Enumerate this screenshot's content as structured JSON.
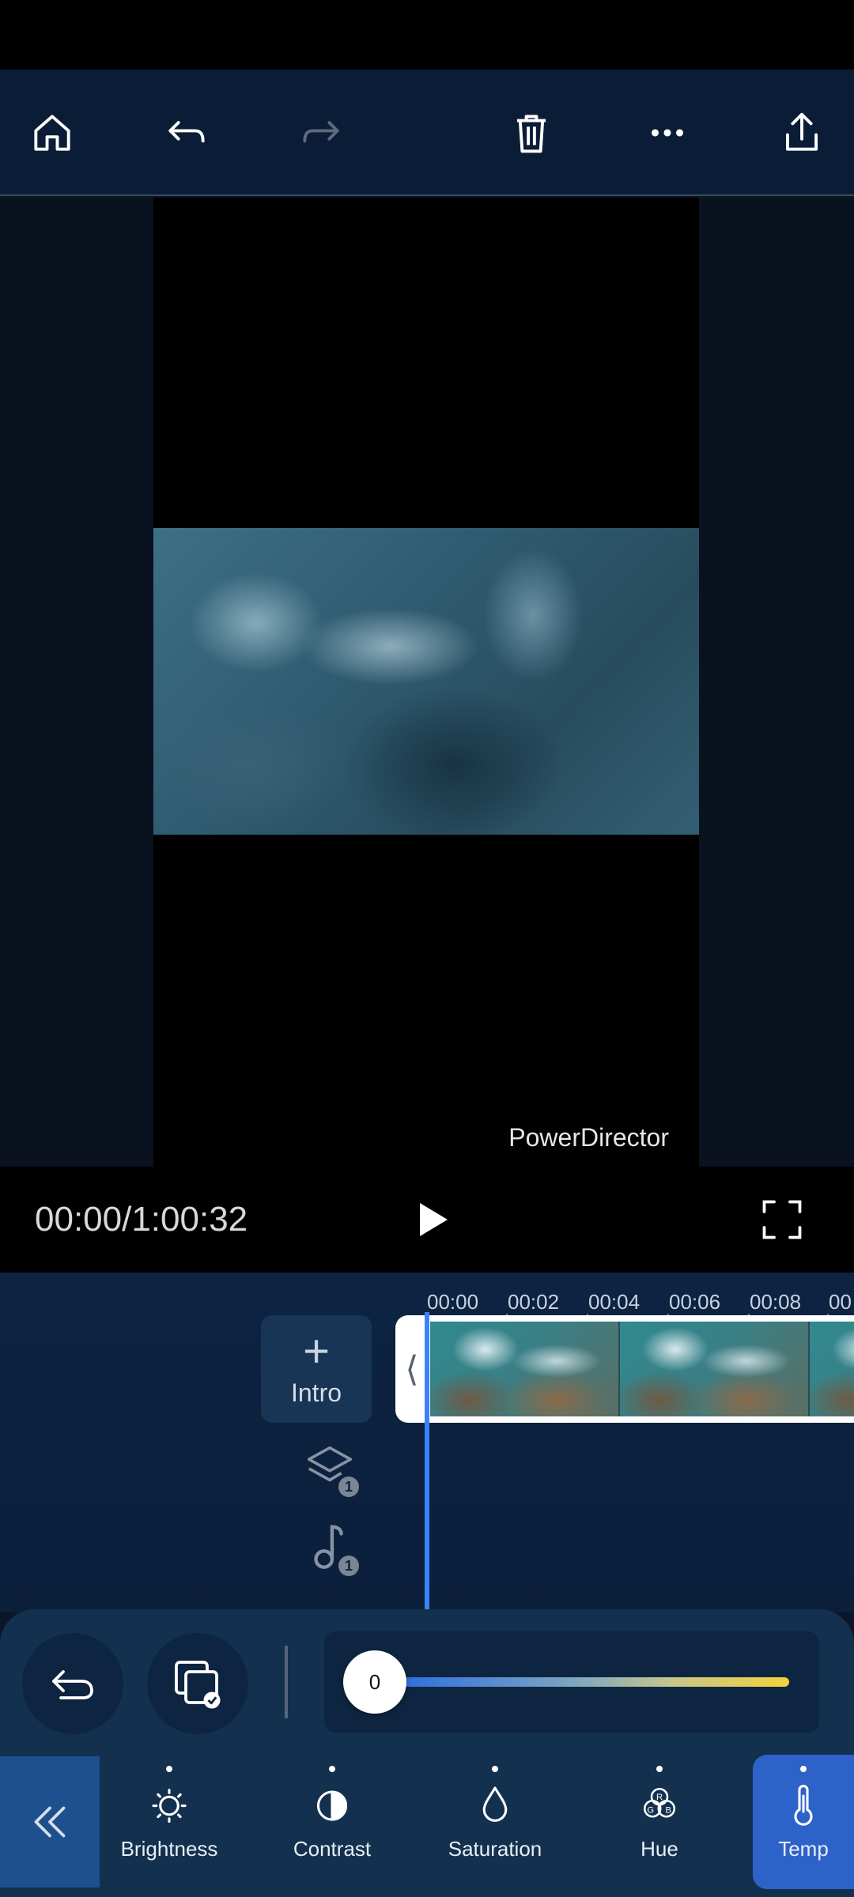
{
  "toolbar": {
    "icons": [
      "home-icon",
      "undo-icon",
      "redo-icon",
      "trash-icon",
      "more-icon",
      "share-icon"
    ]
  },
  "preview": {
    "watermark": "PowerDirector"
  },
  "playback": {
    "timecode": "00:00/1:00:32"
  },
  "timeline": {
    "ruler": [
      "00:00",
      "00:02",
      "00:04",
      "00:06",
      "00:08",
      "00"
    ],
    "intro_label": "Intro",
    "layer_count": "1",
    "music_count": "1"
  },
  "adjust": {
    "slider_value": "0"
  },
  "tools": [
    {
      "label": "Brightness",
      "icon": "brightness-icon"
    },
    {
      "label": "Contrast",
      "icon": "contrast-icon"
    },
    {
      "label": "Saturation",
      "icon": "saturation-icon"
    },
    {
      "label": "Hue",
      "icon": "hue-icon"
    },
    {
      "label": "Temp",
      "icon": "temperature-icon",
      "active": true
    }
  ],
  "colors": {
    "accent": "#3b82f6",
    "active_tab": "#2d63c8",
    "slider_start": "#2f6fe0",
    "slider_end": "#f2d33a"
  }
}
